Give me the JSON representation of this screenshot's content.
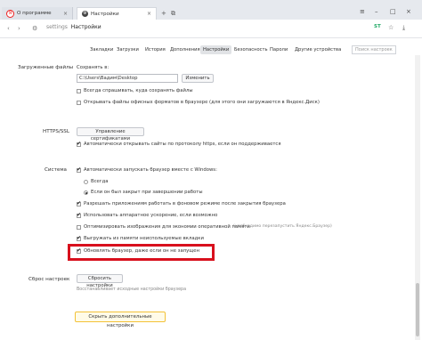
{
  "tabs": [
    {
      "label": "О программе"
    },
    {
      "label": "Настройки"
    }
  ],
  "address": {
    "scheme": "settings",
    "title": "Настройки"
  },
  "toolbar_right": {
    "badge": "ST"
  },
  "nav": {
    "items": [
      "Закладки",
      "Загрузки",
      "История",
      "Дополнения",
      "Настройки",
      "Безопасность",
      "Пароли",
      "Другие устройства"
    ],
    "active": "Настройки",
    "search_placeholder": "Поиск настроек"
  },
  "downloads": {
    "section": "Загруженные файлы",
    "save_in_label": "Сохранять в:",
    "path": "C:\\Users\\Вадим\\Desktop",
    "change_button": "Изменить",
    "ask_where": "Всегда спрашивать, куда сохранять файлы",
    "open_office": "Открывать файлы офисных форматов в браузере (для этого они загружаются в Яндекс.Диск)"
  },
  "https": {
    "section": "HTTPS/SSL",
    "manage_button": "Управление сертификатами",
    "auto_open": "Автоматически открывать сайты по протоколу https, если он поддерживается"
  },
  "system": {
    "section": "Система",
    "autostart": "Автоматически запускать браузер вместе с Windows:",
    "always": "Всегда",
    "if_not_closed": "Если он был закрыт при завершении работы",
    "background": "Разрешать приложениям работать в фоновом режиме после закрытия браузера",
    "hw_accel": "Использовать аппаратное ускорение, если возможно",
    "optimize_images": "Оптимизировать изображения для экономии оперативной памяти",
    "optimize_note": "(необходимо перезапустить Яндекс.Браузер)",
    "unload_tabs": "Выгружать из памяти неиспользуемые вкладки",
    "update_when_closed": "Обновлять браузер, даже если он не запущен"
  },
  "reset": {
    "section": "Сброс настроек",
    "button": "Сбросить настройки",
    "note": "Восстанавливает исходные настройки браузера"
  },
  "hide_more_button": "Скрыть дополнительные настройки",
  "colors": {
    "highlight": "#d8101d",
    "more_button_border": "#f3c238"
  }
}
